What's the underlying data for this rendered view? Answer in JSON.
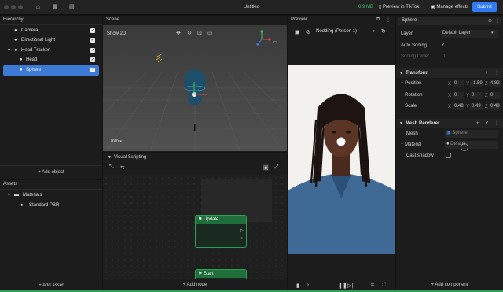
{
  "titlebar": {
    "title": "Untitled",
    "storage": "0.9 MB",
    "preview_label": "Preview in TikTok",
    "manage_label": "Manage effects",
    "submit_label": "Submit"
  },
  "hierarchy": {
    "title": "Hierarchy",
    "items": [
      {
        "label": "Camera"
      },
      {
        "label": "Directional Light"
      },
      {
        "label": "Head Tracker"
      },
      {
        "label": "Head"
      },
      {
        "label": "Sphere"
      }
    ],
    "add_label": "+ Add object"
  },
  "assets": {
    "title": "Assets",
    "folder": "Materials",
    "item": "Standard PBR",
    "add_label": "+ Add asset"
  },
  "scene": {
    "title": "Scene",
    "mode": "Show 2D",
    "info": "Info"
  },
  "visual_scripting": {
    "title": "Visual Scripting",
    "node_update": "Update",
    "node_start": "Start",
    "add_label": "+ Add node"
  },
  "preview": {
    "title": "Preview",
    "effect": "Nodding (Person 1)"
  },
  "inspector": {
    "object_name": "Sphere",
    "layer_label": "Layer",
    "layer_value": "Default Layer",
    "auto_sort_label": "Auto Sorting",
    "sort_order_label": "Sorting Order",
    "sort_order_value": "1",
    "transform_title": "Transform",
    "position_label": "Position",
    "position": [
      "0",
      "-1.59",
      "4.82"
    ],
    "rotation_label": "Rotation",
    "rotation": [
      "0",
      "0",
      "0"
    ],
    "scale_label": "Scale",
    "scale": [
      "0.49",
      "0.49",
      "0.49"
    ],
    "axis": [
      "X",
      "Y",
      "Z"
    ],
    "mesh_renderer_title": "Mesh Renderer",
    "mesh_label": "Mesh",
    "mesh_value": "Sphere",
    "material_label": "Material",
    "material_value": "Default",
    "cast_shadow_label": "Cast shadow",
    "add_label": "+ Add component"
  },
  "colors": {
    "accent": "#2f7bf5",
    "selection": "#3d7ad6",
    "node_green": "#2f9f55",
    "storage_green": "#35c46b"
  }
}
